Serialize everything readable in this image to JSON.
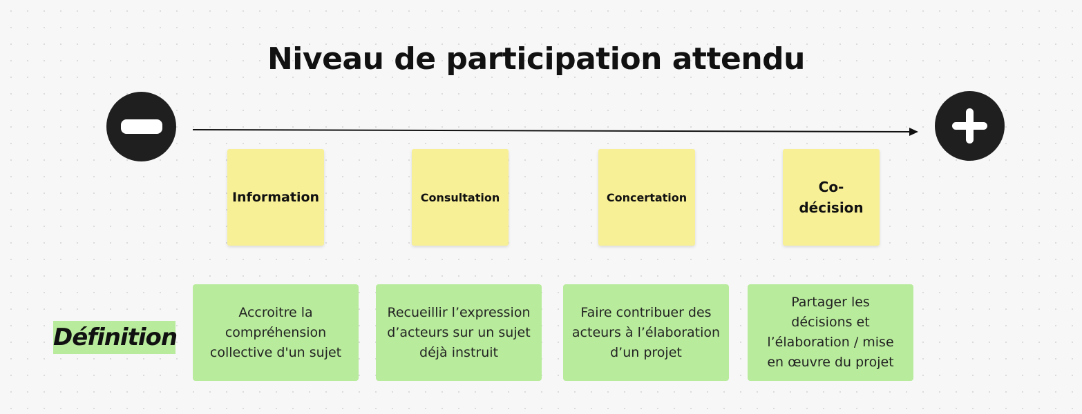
{
  "title": "Niveau de participation attendu",
  "scale": {
    "low_icon": "minus-icon",
    "high_icon": "plus-icon"
  },
  "levels": [
    {
      "label": "Information",
      "definition": "Accroitre la compréhension collective d'un sujet"
    },
    {
      "label": "Consultation",
      "definition": "Recueillir l’expression d’acteurs sur un sujet déjà instruit"
    },
    {
      "label": "Concertation",
      "definition": "Faire contribuer des acteurs à l’élaboration d’un projet"
    },
    {
      "label": "Co-\ndécision",
      "definition": "Partager les décisions et l’élaboration / mise en œuvre du projet"
    }
  ],
  "definition_label": "Définition",
  "colors": {
    "sticky": "#f8f096",
    "definition": "#b8eb9c",
    "icon_circle": "#1f1f1f",
    "arrow": "#111111"
  }
}
